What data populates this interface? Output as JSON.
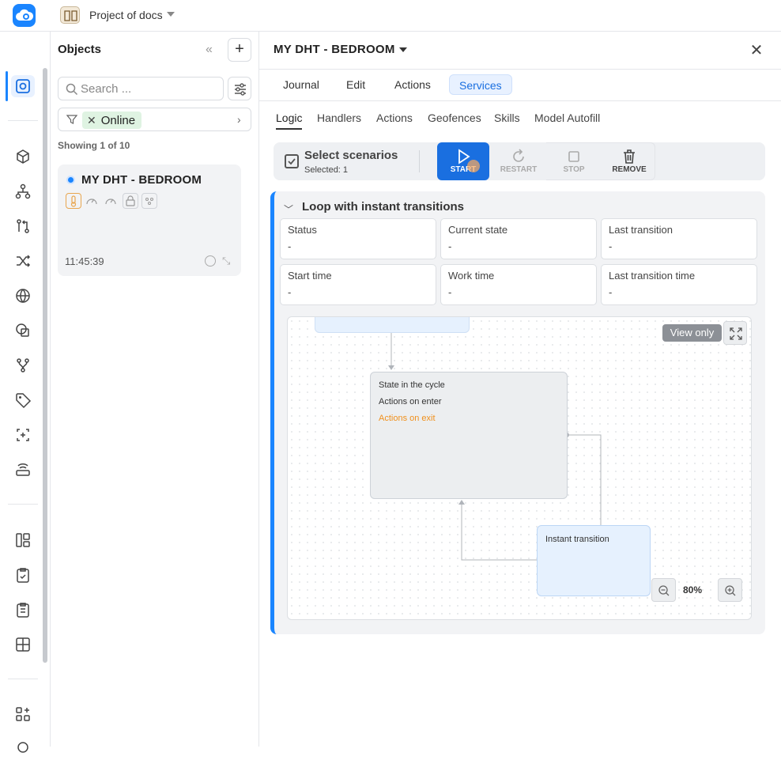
{
  "header": {
    "project_title": "Project of docs"
  },
  "objects_panel": {
    "title": "Objects",
    "search": {
      "placeholder": "Search ..."
    },
    "filter_chip": "Online",
    "showing": "Showing 1 of 10",
    "card": {
      "title": "MY DHT - BEDROOM",
      "time": "11:45:39",
      "status_color": "#1a85ff"
    }
  },
  "detail": {
    "title": "MY DHT - BEDROOM",
    "tabs": [
      {
        "label": "Journal"
      },
      {
        "label": "Edit"
      },
      {
        "label": "Actions"
      },
      {
        "label": "Services"
      }
    ],
    "subtabs": [
      {
        "label": "Logic"
      },
      {
        "label": "Handlers"
      },
      {
        "label": "Actions"
      },
      {
        "label": "Geofences"
      },
      {
        "label": "Skills"
      },
      {
        "label": "Model Autofill"
      }
    ],
    "toolbar": {
      "select_title": "Select scenarios",
      "selected": "Selected: 1",
      "start": "START",
      "restart": "RESTART",
      "stop": "STOP",
      "remove": "REMOVE"
    },
    "scenario": {
      "title": "Loop with instant transitions",
      "fields": [
        {
          "label": "Status",
          "value": "-"
        },
        {
          "label": "Current state",
          "value": "-"
        },
        {
          "label": "Last transition",
          "value": "-"
        },
        {
          "label": "Start time",
          "value": "-"
        },
        {
          "label": "Work time",
          "value": "-"
        },
        {
          "label": "Last transition time",
          "value": "-"
        }
      ],
      "diagram": {
        "state_title": "State in the cycle",
        "actions_on_enter": "Actions on enter",
        "actions_on_exit": "Actions on exit",
        "instant_title": "Instant transition",
        "view_only": "View only",
        "zoom": "80%"
      }
    }
  },
  "colors": {
    "accent": "#1a85ff",
    "start_button": "#1a6fe0",
    "exit_action": "#f0901c",
    "online_chip": "#dff3e2"
  }
}
